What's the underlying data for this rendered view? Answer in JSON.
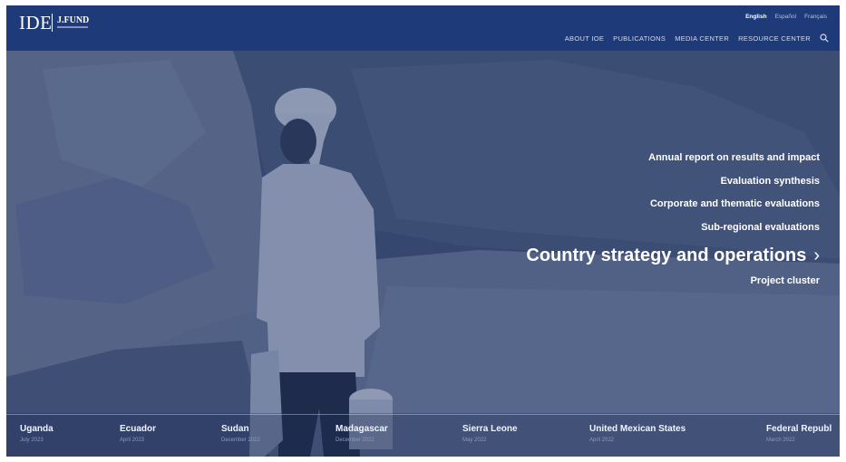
{
  "header": {
    "logo": {
      "primary": "IDE",
      "secondary": "J.FUND"
    },
    "languages": [
      {
        "label": "English",
        "active": true
      },
      {
        "label": "Español",
        "active": false
      },
      {
        "label": "Français",
        "active": false
      }
    ],
    "nav": [
      {
        "label": "ABOUT IOE"
      },
      {
        "label": "PUBLICATIONS"
      },
      {
        "label": "MEDIA CENTER"
      },
      {
        "label": "RESOURCE CENTER"
      }
    ],
    "search_icon": "search-icon"
  },
  "menu": {
    "items": [
      {
        "label": "Annual report on results and impact"
      },
      {
        "label": "Evaluation synthesis"
      },
      {
        "label": "Corporate and thematic evaluations"
      },
      {
        "label": "Sub-regional evaluations"
      }
    ],
    "featured": {
      "label": "Country strategy and operations",
      "icon": "chevron-right-icon",
      "glyph": "›"
    },
    "last": {
      "label": "Project cluster"
    }
  },
  "countries": [
    {
      "name": "Uganda",
      "date": "July 2023"
    },
    {
      "name": "Ecuador",
      "date": "April 2023"
    },
    {
      "name": "Sudan",
      "date": "December 2022"
    },
    {
      "name": "Madagascar",
      "date": "December 2022"
    },
    {
      "name": "Sierra Leone",
      "date": "May 2022"
    },
    {
      "name": "United Mexican States",
      "date": "April 2022"
    },
    {
      "name": "Federal Republ",
      "date": "March 2022"
    }
  ],
  "colors": {
    "header_bg": "#1f3a78",
    "photo_tint": "#3d4f76",
    "text_primary": "#ffffff"
  }
}
